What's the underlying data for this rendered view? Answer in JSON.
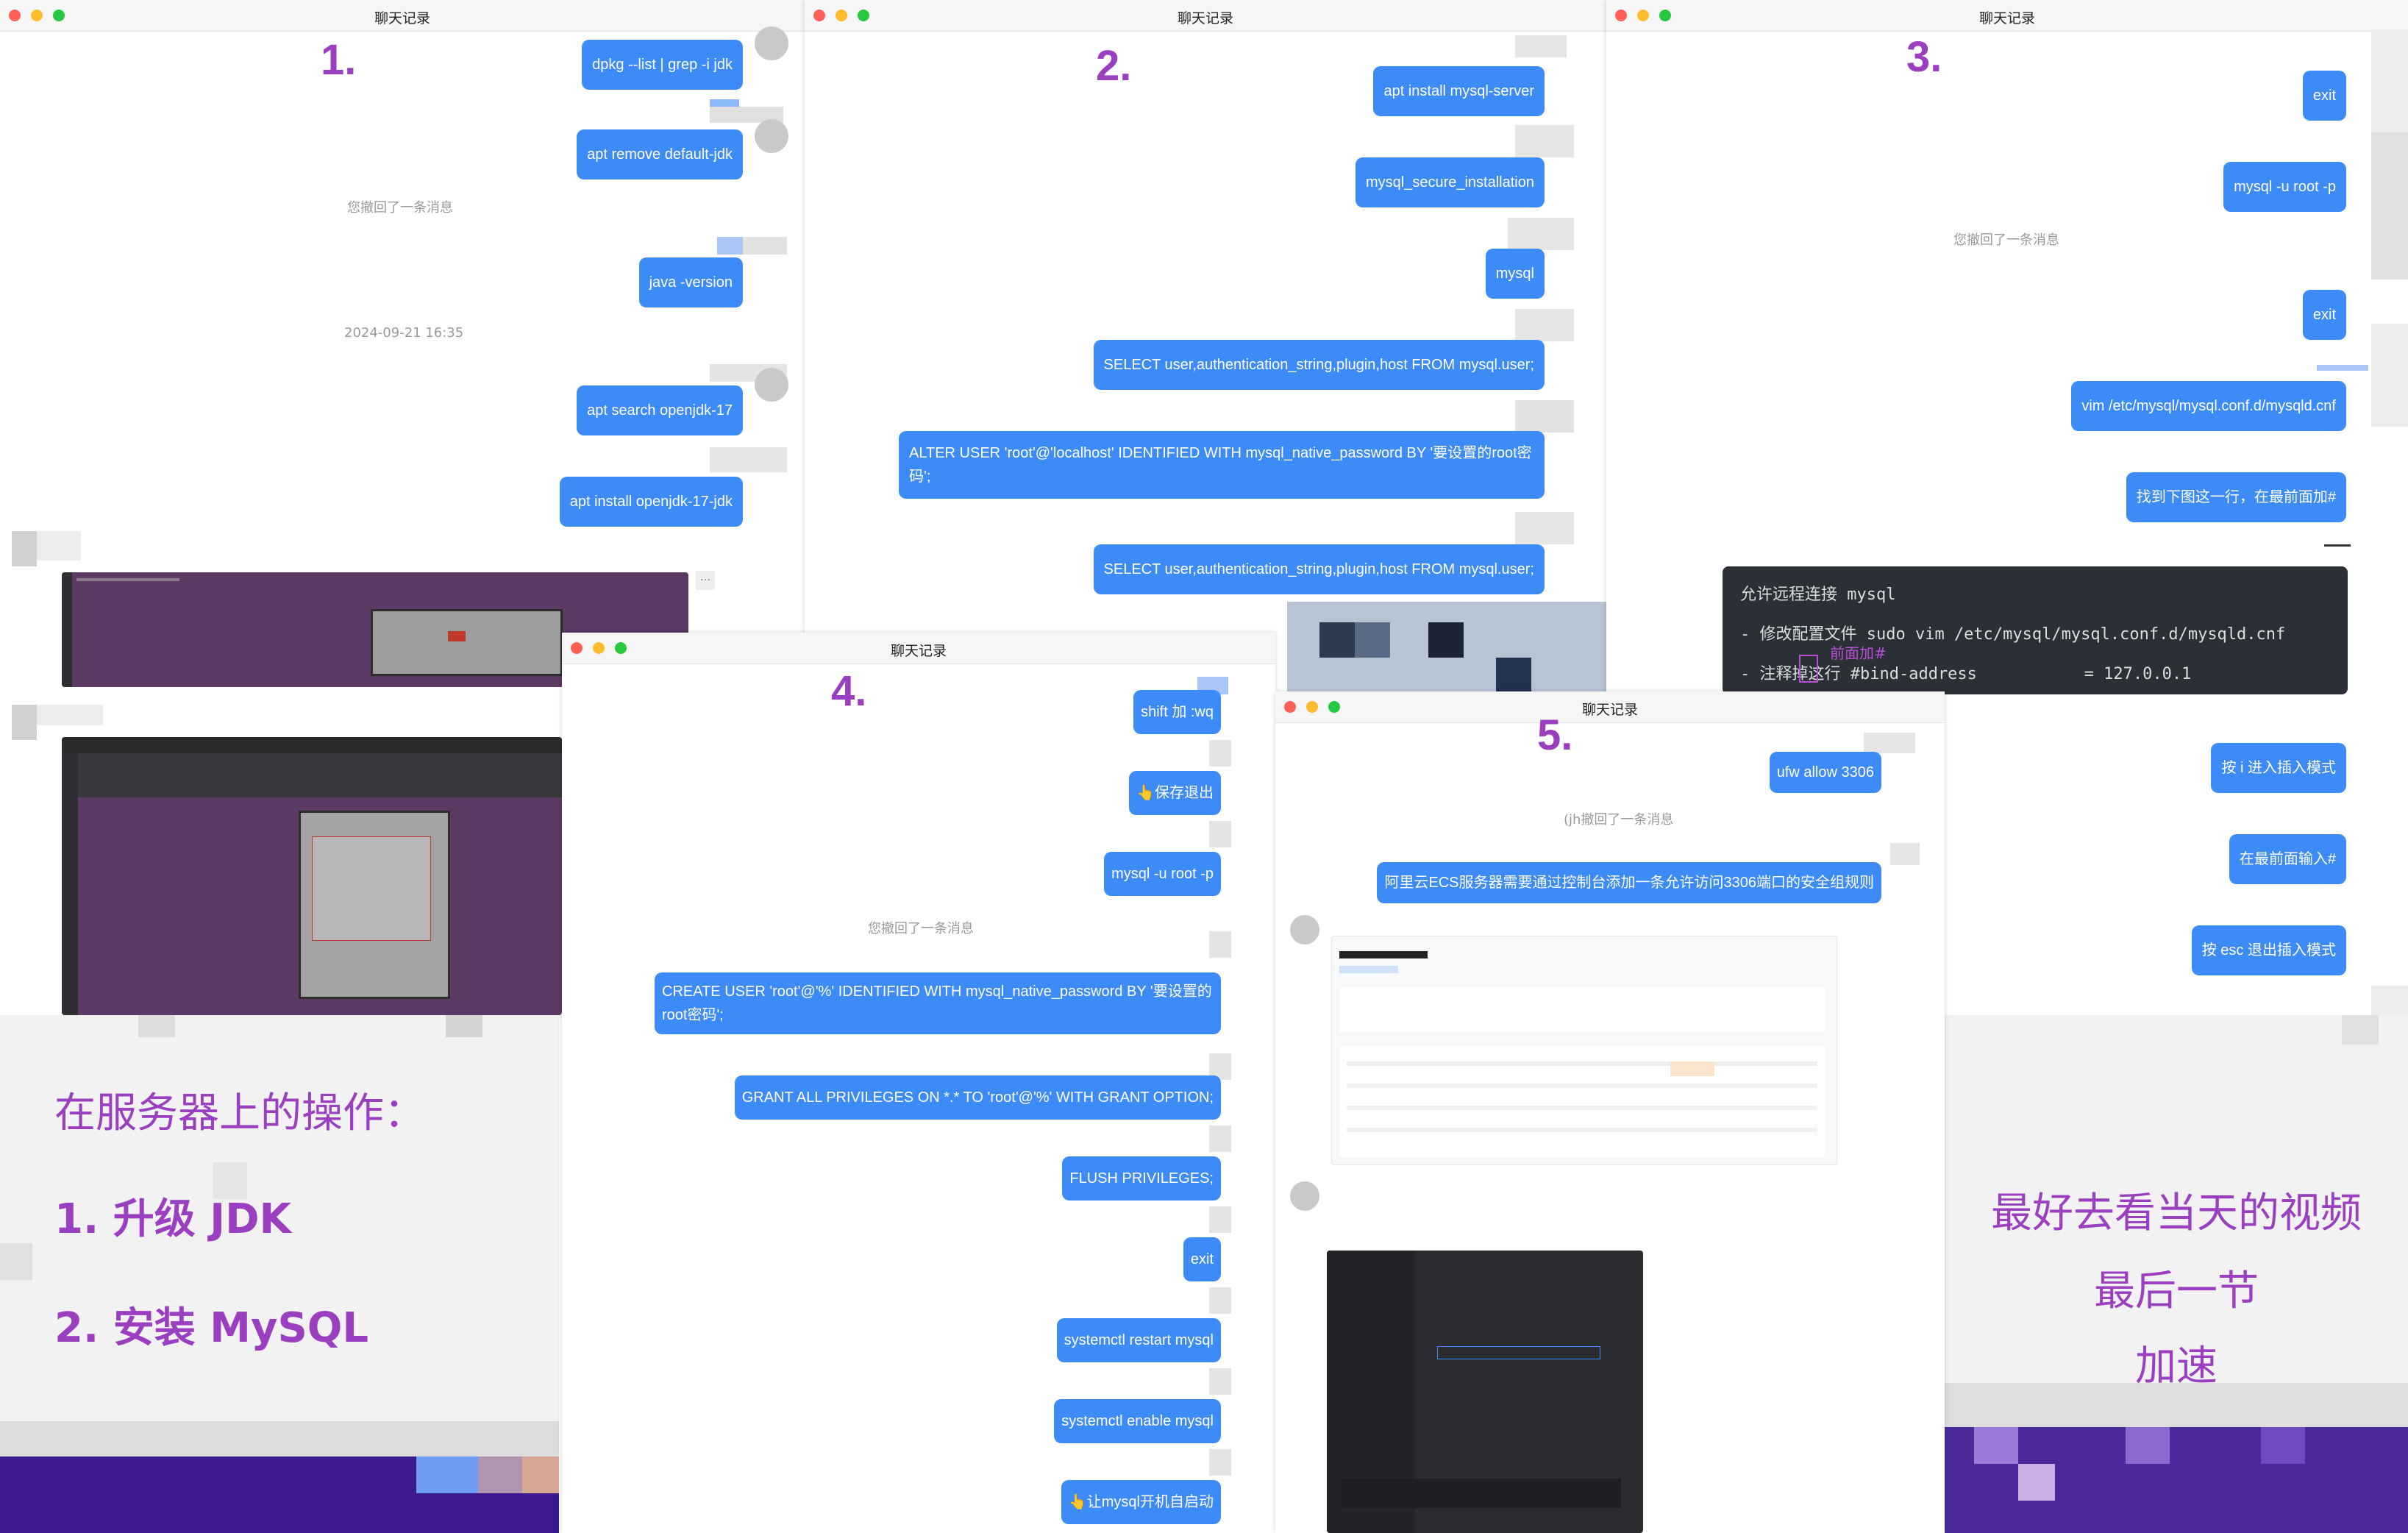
{
  "windows": {
    "w1": {
      "title": "聊天记录",
      "step": "1.",
      "messages": [
        "dpkg --list | grep -i jdk",
        "apt remove default-jdk",
        "java -version",
        "apt search openjdk-17",
        "apt install openjdk-17-jdk"
      ],
      "recalled": "您撤回了一条消息",
      "timestamp": "2024-09-21 16:35",
      "more": "···"
    },
    "w2": {
      "title": "聊天记录",
      "step": "2.",
      "messages": [
        "apt install mysql-server",
        "mysql_secure_installation",
        "mysql",
        "SELECT user,authentication_string,plugin,host FROM mysql.user;",
        "ALTER USER 'root'@'localhost' IDENTIFIED WITH mysql_native_password BY '要设置的root密码';",
        "SELECT user,authentication_string,plugin,host FROM mysql.user;"
      ]
    },
    "w3": {
      "title": "聊天记录",
      "step": "3.",
      "messages": [
        "exit",
        "mysql -u root -p",
        "exit",
        "vim /etc/mysql/mysql.conf.d/mysqld.cnf",
        "找到下图这一行，在最前面加#",
        "按 i 进入插入模式",
        "在最前面输入#",
        "按 esc 退出插入模式"
      ],
      "recalled": "您撤回了一条消息",
      "code": {
        "line1": "允许远程连接 mysql",
        "line2": "- 修改配置文件 sudo vim /etc/mysql/mysql.conf.d/mysqld.cnf",
        "line3": "- 注释掉这行 #bind-address           = 127.0.0.1",
        "note": "前面加#"
      }
    },
    "w4": {
      "title": "聊天记录",
      "step": "4.",
      "messages": [
        "shift 加 :wq",
        "👆保存退出",
        "mysql -u root -p",
        "CREATE USER 'root'@'%' IDENTIFIED WITH mysql_native_password BY '要设置的root密码';",
        "GRANT ALL PRIVILEGES ON *.* TO 'root'@'%' WITH GRANT OPTION;",
        "FLUSH PRIVILEGES;",
        "exit",
        "systemctl restart mysql",
        "systemctl enable mysql",
        "👆让mysql开机自启动"
      ],
      "recalled": "您撤回了一条消息"
    },
    "w5": {
      "title": "聊天记录",
      "step": "5.",
      "messages": [
        "ufw allow 3306",
        "阿里云ECS服务器需要通过控制台添加一条允许访问3306端口的安全组规则"
      ],
      "recalled": "(jh撤回了一条消息"
    }
  },
  "panels": {
    "left": {
      "heading": "在服务器上的操作：",
      "item1": "1. 升级 JDK",
      "item2": "2. 安装 MySQL"
    },
    "right": {
      "line1": "最好去看当天的视频",
      "line2": "最后一节",
      "line3": "加速"
    }
  },
  "colors": {
    "accent": "#3d8bf7",
    "purple": "#9b3fc1",
    "terminal": "#5b3a63"
  }
}
